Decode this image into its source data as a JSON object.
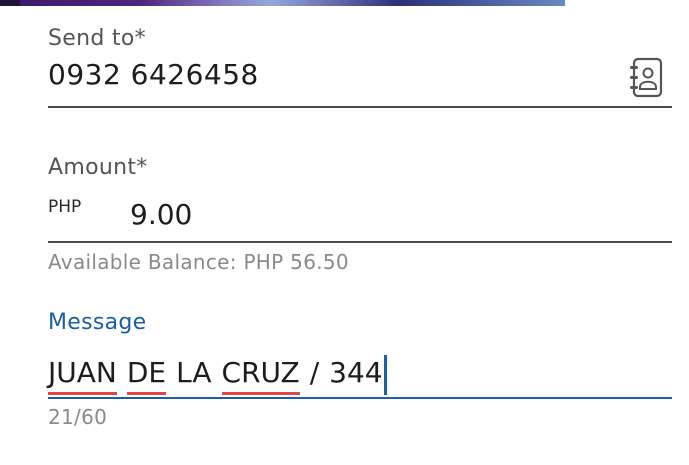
{
  "send_to": {
    "label": "Send to*",
    "value": "0932 6426458",
    "contact_icon": "contact-book-icon"
  },
  "amount": {
    "label": "Amount*",
    "currency": "PHP",
    "value": "9.00",
    "helper": "Available Balance: PHP 56.50"
  },
  "message": {
    "label": "Message",
    "words": [
      "JUAN",
      "DE",
      "LA",
      "CRUZ",
      "/",
      "344"
    ],
    "misspelled": [
      true,
      true,
      false,
      true,
      false,
      false
    ],
    "counter": "21/60",
    "accent_color": "#1a5fa8"
  }
}
